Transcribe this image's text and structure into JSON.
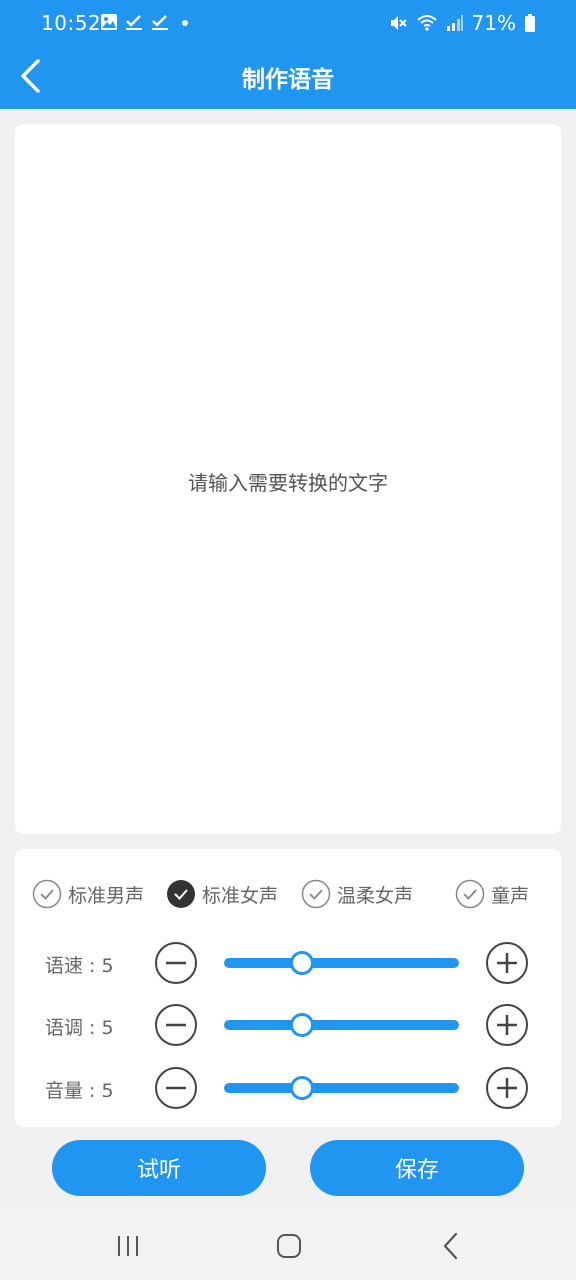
{
  "status_bar": {
    "time": "10:52",
    "battery": "71%",
    "left_icons": [
      "image-icon",
      "check-underline-icon",
      "check-underline-icon",
      "dot-icon"
    ],
    "right_icons": [
      "mute-icon",
      "wifi-icon",
      "signal-icon",
      "battery-icon"
    ]
  },
  "header": {
    "title": "制作语音",
    "back_icon": "chevron-left-icon",
    "background": "#2196f0"
  },
  "text_input": {
    "placeholder": "请输入需要转换的文字",
    "value": ""
  },
  "voices": [
    {
      "label": "标准男声",
      "selected": false
    },
    {
      "label": "标准女声",
      "selected": true
    },
    {
      "label": "温柔女声",
      "selected": false
    },
    {
      "label": "童声",
      "selected": false
    }
  ],
  "params": [
    {
      "label": "语速 : 5",
      "value": 5,
      "min": 0,
      "max": 15
    },
    {
      "label": "语调 : 5",
      "value": 5,
      "min": 0,
      "max": 15
    },
    {
      "label": "音量 : 5",
      "value": 5,
      "min": 0,
      "max": 15
    }
  ],
  "buttons": {
    "listen": "试听",
    "save": "保存"
  },
  "nav_bar": {
    "icons": [
      "recent-apps-icon",
      "home-icon",
      "back-icon"
    ]
  },
  "colors": {
    "accent": "#2196f0",
    "selected_check": "#333333"
  }
}
